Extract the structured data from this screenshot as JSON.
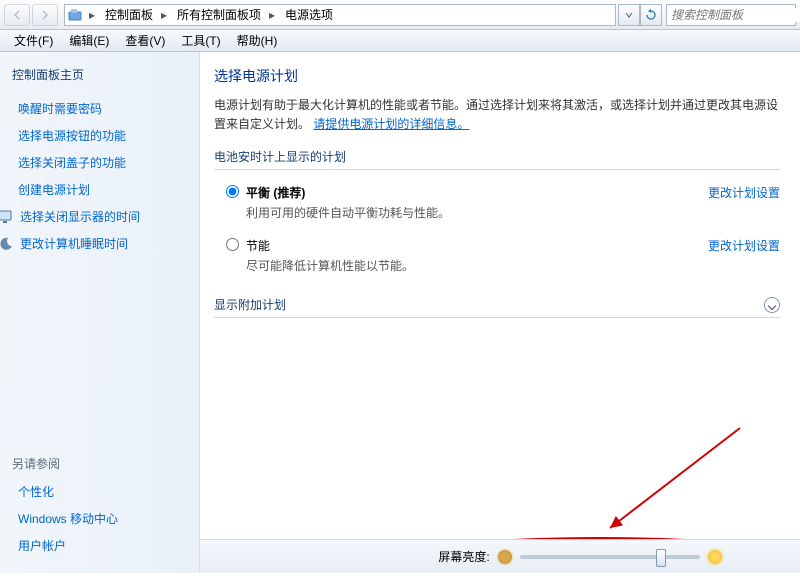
{
  "breadcrumb": {
    "items": [
      "控制面板",
      "所有控制面板项",
      "电源选项"
    ]
  },
  "search": {
    "placeholder": "搜索控制面板"
  },
  "menubar": [
    {
      "label": "文件(F)"
    },
    {
      "label": "编辑(E)"
    },
    {
      "label": "查看(V)"
    },
    {
      "label": "工具(T)"
    },
    {
      "label": "帮助(H)"
    }
  ],
  "sidebar": {
    "title": "控制面板主页",
    "links": [
      {
        "label": "唤醒时需要密码",
        "icon": ""
      },
      {
        "label": "选择电源按钮的功能",
        "icon": ""
      },
      {
        "label": "选择关闭盖子的功能",
        "icon": ""
      },
      {
        "label": "创建电源计划",
        "icon": ""
      },
      {
        "label": "选择关闭显示器的时间",
        "icon": "monitor"
      },
      {
        "label": "更改计算机睡眠时间",
        "icon": "moon"
      }
    ],
    "see_also_title": "另请参阅",
    "see_also": [
      {
        "label": "个性化"
      },
      {
        "label": "Windows 移动中心"
      },
      {
        "label": "用户帐户"
      }
    ]
  },
  "main": {
    "title": "选择电源计划",
    "desc_prefix": "电源计划有助于最大化计算机的性能或者节能。通过选择计划来将其激活，或选择计划并通过更改其电源设置来自定义计划。",
    "desc_link": "请提供电源计划的详细信息。",
    "group1": "电池安时计上显示的计划",
    "plans": [
      {
        "name": "平衡 (推荐)",
        "sub": "利用可用的硬件自动平衡功耗与性能。",
        "action": "更改计划设置",
        "checked": true
      },
      {
        "name": "节能",
        "sub": "尽可能降低计算机性能以节能。",
        "action": "更改计划设置",
        "checked": false
      }
    ],
    "group2": "显示附加计划"
  },
  "brightness": {
    "label": "屏幕亮度:",
    "value_percent": 80
  }
}
